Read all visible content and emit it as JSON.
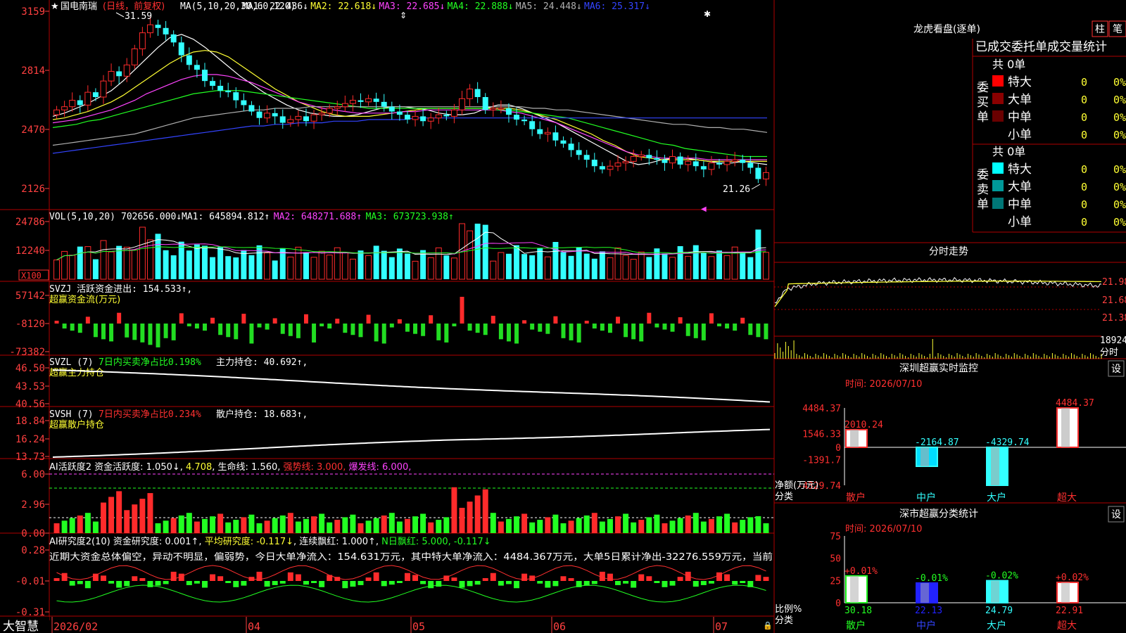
{
  "app": {
    "name": "大智慧",
    "stock_name": "国电南瑞",
    "period": "日线，前复权"
  },
  "colors": {
    "up": "#ff2b2b",
    "down": "#33ffff",
    "bg": "#000000",
    "grid": "#b00000",
    "axis_label": "#ff4040",
    "yellow": "#ffff33",
    "magenta": "#ff44ff",
    "green": "#22ff22",
    "white": "#ffffff",
    "blue": "#3344ff",
    "gray": "#b0b0b0"
  },
  "kline": {
    "ma_header": "MA(5,10,20,30,60,120)",
    "ma_items": [
      {
        "label": "MA1: 22.436↓",
        "color": "#ffffff"
      },
      {
        "label": "MA2: 22.618↓",
        "color": "#ffff33"
      },
      {
        "label": "MA3: 22.685↓",
        "color": "#ff44ff"
      },
      {
        "label": "MA4: 22.888↓",
        "color": "#22ff22"
      },
      {
        "label": "MA5: 24.448↓",
        "color": "#b0b0b0"
      },
      {
        "label": "MA6: 25.317↓",
        "color": "#3344ff"
      }
    ],
    "y_ticks": [
      "3159",
      "2814",
      "2470",
      "2126"
    ],
    "high_label": "31.59",
    "low_label": "21.26"
  },
  "vol": {
    "header": "VOL(5,10,20)",
    "value": "702656.000↓",
    "ma_items": [
      {
        "label": "MA1: 645894.812↑",
        "color": "#ffffff"
      },
      {
        "label": "MA2: 648271.688↑",
        "color": "#ff44ff"
      },
      {
        "label": "MA3: 673723.938↑",
        "color": "#22ff22"
      }
    ],
    "y_ticks": [
      "24786",
      "12240"
    ],
    "unit": "X100"
  },
  "svzj": {
    "header": "SVZJ  活跃资金进出: 154.533↑,",
    "sub": "超赢资金流(万元)",
    "y_ticks": [
      "57142",
      "-8120",
      "-73382"
    ]
  },
  "svzl": {
    "header": "SVZL (7) ",
    "ratio": "7日内买卖净占比0.198%",
    "main": "主力持仓: 40.692↑,",
    "sub": "超赢主力持仓",
    "y_ticks": [
      "46.50",
      "43.53",
      "40.56"
    ]
  },
  "svsh": {
    "header": "SVSH (7) ",
    "ratio": "7日内买卖净占比0.234%",
    "main": "散户持仓: 18.683↑,",
    "sub": "超赢散户持仓",
    "y_ticks": [
      "18.84",
      "16.24",
      "13.73"
    ]
  },
  "ai_hy": {
    "header": "AI活跃度2 资金活跃度: 1.050↓, ",
    "val2": "4.708",
    "life": ", 生命线: 1.560, ",
    "strong": "强势线: 3.000, ",
    "burst": "爆发线: 6.000,",
    "y_ticks": [
      "6.00",
      "2.96",
      "0.00"
    ]
  },
  "ai_yj": {
    "header": "AI研究度2(10) 资金研究度: 0.001↑, ",
    "avg": "平均研究度: -0.117↓",
    "lx": ", 连续飘红: 1.000↑, ",
    "nr": "N日飘红: 5.000, -0.117↓",
    "comment": "近期大资金总体偏空，异动不明显，偏弱势，今日大单净流入：154.631万元，其中特大单净流入：4484.367万元，大单5日累计净出-32276.559万元，当前",
    "y_ticks": [
      "0.28",
      "-0.01",
      "-0.31"
    ]
  },
  "xaxis": {
    "labels": [
      "2026/02",
      "04",
      "05",
      "06",
      "07"
    ]
  },
  "dragon": {
    "title": "龙虎看盘(逐单)",
    "btn1": "柱",
    "btn2": "笔",
    "tabs": [
      "已成交",
      "委托单",
      "成交量",
      "统计"
    ],
    "buy_label": "委买单",
    "sell_label": "委卖单",
    "buy_total": "共 0单",
    "sell_total": "共 0单",
    "buy_rows": [
      {
        "name": "特大",
        "val": "0",
        "pct": "0%",
        "color": "#ff0000"
      },
      {
        "name": "大单",
        "val": "0",
        "pct": "0%",
        "color": "#8a0000"
      },
      {
        "name": "中单",
        "val": "0",
        "pct": "0%",
        "color": "#6a0000"
      },
      {
        "name": "小单",
        "val": "0",
        "pct": "0%",
        "color": "#000000"
      }
    ],
    "sell_rows": [
      {
        "name": "特大",
        "val": "0",
        "pct": "0%",
        "color": "#00ffff"
      },
      {
        "name": "大单",
        "val": "0",
        "pct": "0%",
        "color": "#009999"
      },
      {
        "name": "中单",
        "val": "0",
        "pct": "0%",
        "color": "#007777"
      },
      {
        "name": "小单",
        "val": "0",
        "pct": "0%",
        "color": "#000000"
      }
    ]
  },
  "intraday": {
    "title": "分时走势",
    "y_ticks": [
      "21.98",
      "21.68",
      "21.38"
    ],
    "vol_tick": "18924",
    "vol_unit": "分时"
  },
  "monitor": {
    "title": "深圳超赢实时监控",
    "btn": "设",
    "time": "时间: 2026/07/10",
    "y_ticks": [
      "4484.37",
      "1546.33",
      "0",
      "-1391.7",
      "-4329.74"
    ],
    "ylabel": "净额(万元)",
    "xlabel": "分类",
    "categories": [
      "散户",
      "中户",
      "大户",
      "超大"
    ],
    "values_labels": [
      "2010.24",
      "-2164.87",
      "-4329.74",
      "4484.37"
    ]
  },
  "classify": {
    "title": "深市超赢分类统计",
    "btn": "设",
    "time": "时间: 2026/07/10",
    "y_ticks": [
      "75",
      "50",
      "25",
      "0"
    ],
    "ylabel": "比例%",
    "xlabel": "分类",
    "categories": [
      "散户",
      "中户",
      "大户",
      "超大"
    ],
    "values_labels": [
      "30.18",
      "22.13",
      "24.79",
      "22.91"
    ],
    "change_labels": [
      "+0.01%",
      "-0.01%",
      "-0.02%",
      "+0.02%"
    ]
  },
  "chart_data": [
    {
      "type": "candlestick",
      "title": "国电南瑞",
      "x": [
        "2026/02",
        "04",
        "05",
        "06",
        "07"
      ],
      "ylim": [
        21.26,
        31.59
      ],
      "close": [
        25.8,
        26.0,
        26.4,
        26.1,
        26.9,
        26.6,
        27.6,
        28.2,
        27.9,
        28.6,
        29.6,
        30.6,
        31.1,
        30.9,
        30.5,
        30.0,
        29.2,
        28.6,
        28.3,
        27.6,
        27.3,
        27.0,
        26.9,
        26.4,
        26.1,
        25.7,
        25.3,
        25.6,
        25.4,
        25.0,
        25.2,
        25.4,
        25.1,
        25.5,
        25.6,
        25.9,
        26.0,
        26.2,
        26.4,
        26.3,
        26.5,
        26.3,
        26.0,
        25.7,
        25.5,
        25.2,
        25.4,
        25.1,
        25.3,
        25.5,
        25.4,
        25.8,
        26.5,
        27.1,
        26.6,
        25.8,
        25.9,
        25.9,
        25.5,
        25.2,
        25.1,
        24.6,
        24.3,
        24.4,
        23.9,
        23.7,
        23.3,
        23.0,
        22.7,
        22.3,
        22.1,
        22.3,
        22.5,
        22.6,
        22.9,
        23.0,
        22.8,
        22.7,
        22.5,
        22.9,
        22.4,
        22.6,
        22.3,
        22.1,
        22.5,
        22.4,
        22.6,
        22.7,
        22.5,
        22.2,
        21.5,
        21.9
      ],
      "series": [
        {
          "name": "MA1",
          "values": [
            25.4,
            25.6,
            25.9,
            26.2,
            26.6,
            27.0,
            27.6,
            28.3,
            29.0,
            29.7,
            30.3,
            30.5,
            30.2,
            29.7,
            29.1,
            28.5,
            27.9,
            27.4,
            26.9,
            26.5,
            26.1,
            25.8,
            25.6,
            25.5,
            25.4,
            25.4,
            25.5,
            25.7,
            25.9,
            26.0,
            26.0,
            25.9,
            25.8,
            25.6,
            25.5,
            25.5,
            25.6,
            25.9,
            26.1,
            26.1,
            25.9,
            25.6,
            25.3,
            25.0,
            24.6,
            24.2,
            23.8,
            23.4,
            23.0,
            22.6,
            22.4,
            22.5,
            22.7,
            22.8,
            22.8,
            22.7,
            22.6,
            22.5,
            22.5,
            22.6,
            22.5,
            22.4
          ]
        },
        {
          "name": "MA2",
          "values": [
            25.2,
            25.3,
            25.5,
            25.7,
            26.0,
            26.3,
            26.7,
            27.2,
            27.7,
            28.2,
            28.7,
            29.1,
            29.4,
            29.5,
            29.4,
            29.1,
            28.6,
            28.1,
            27.6,
            27.1,
            26.7,
            26.3,
            26.0,
            25.7,
            25.5,
            25.4,
            25.4,
            25.4,
            25.5,
            25.6,
            25.7,
            25.8,
            25.9,
            25.9,
            25.9,
            25.9,
            25.9,
            25.9,
            25.9,
            25.9,
            25.8,
            25.6,
            25.4,
            25.2,
            24.9,
            24.6,
            24.3,
            23.9,
            23.6,
            23.2,
            22.9,
            22.8,
            22.7,
            22.7,
            22.7,
            22.7,
            22.6,
            22.6,
            22.6,
            22.6,
            22.6,
            22.6
          ]
        },
        {
          "name": "MA3",
          "values": [
            25.0,
            25.1,
            25.2,
            25.4,
            25.6,
            25.8,
            26.1,
            26.4,
            26.8,
            27.1,
            27.4,
            27.7,
            27.9,
            28.0,
            28.0,
            27.9,
            27.7,
            27.5,
            27.2,
            26.9,
            26.6,
            26.3,
            26.1,
            25.9,
            25.8,
            25.7,
            25.6,
            25.6,
            25.6,
            25.6,
            25.7,
            25.7,
            25.8,
            25.8,
            25.8,
            25.8,
            25.8,
            25.8,
            25.8,
            25.7,
            25.6,
            25.4,
            25.2,
            25.0,
            24.7,
            24.4,
            24.1,
            23.8,
            23.5,
            23.2,
            23.0,
            22.9,
            22.8,
            22.8,
            22.8,
            22.8,
            22.7,
            22.7,
            22.7,
            22.7,
            22.7,
            22.7
          ]
        },
        {
          "name": "MA4",
          "values": [
            24.7,
            24.8,
            24.9,
            25.1,
            25.2,
            25.4,
            25.6,
            25.8,
            26.0,
            26.2,
            26.4,
            26.6,
            26.8,
            26.9,
            27.0,
            27.0,
            27.0,
            26.9,
            26.8,
            26.7,
            26.6,
            26.5,
            26.4,
            26.3,
            26.2,
            26.1,
            26.0,
            25.9,
            25.9,
            25.9,
            25.9,
            25.9,
            25.9,
            25.9,
            25.9,
            25.9,
            25.9,
            25.9,
            25.8,
            25.8,
            25.7,
            25.6,
            25.5,
            25.4,
            25.3,
            25.1,
            24.9,
            24.7,
            24.5,
            24.3,
            24.1,
            23.9,
            23.7,
            23.6,
            23.4,
            23.3,
            23.2,
            23.1,
            23.0,
            22.9,
            22.9,
            22.9
          ]
        },
        {
          "name": "MA5",
          "values": [
            23.6,
            23.7,
            23.8,
            23.9,
            24.0,
            24.1,
            24.2,
            24.3,
            24.5,
            24.7,
            24.9,
            25.1,
            25.3,
            25.4,
            25.5,
            25.6,
            25.7,
            25.8,
            25.8,
            25.9,
            25.9,
            25.9,
            26.0,
            26.0,
            26.0,
            26.0,
            26.0,
            26.0,
            26.0,
            26.0,
            26.0,
            26.0,
            26.0,
            26.0,
            26.0,
            26.0,
            26.0,
            26.0,
            26.0,
            26.0,
            26.0,
            25.9,
            25.9,
            25.8,
            25.8,
            25.7,
            25.6,
            25.5,
            25.4,
            25.3,
            25.2,
            25.1,
            25.0,
            24.9,
            24.9,
            24.8,
            24.7,
            24.7,
            24.6,
            24.6,
            24.5,
            24.4
          ]
        },
        {
          "name": "MA6",
          "values": [
            23.1,
            23.2,
            23.3,
            23.4,
            23.5,
            23.6,
            23.7,
            23.8,
            23.9,
            24.0,
            24.1,
            24.2,
            24.3,
            24.4,
            24.5,
            24.6,
            24.7,
            24.8,
            24.8,
            24.9,
            24.9,
            25.0,
            25.0,
            25.0,
            25.1,
            25.1,
            25.1,
            25.2,
            25.2,
            25.2,
            25.2,
            25.3,
            25.3,
            25.3,
            25.3,
            25.3,
            25.3,
            25.3,
            25.3,
            25.3,
            25.3,
            25.3,
            25.3,
            25.3,
            25.3,
            25.3,
            25.3,
            25.3,
            25.3,
            25.3,
            25.3,
            25.3,
            25.3,
            25.3,
            25.3,
            25.3,
            25.3,
            25.3,
            25.3,
            25.3,
            25.3,
            25.3
          ]
        }
      ]
    },
    {
      "type": "bar",
      "title": "深圳超赢实时监控",
      "categories": [
        "散户",
        "中户",
        "大户",
        "超大"
      ],
      "values": [
        2010.24,
        -2164.87,
        -4329.74,
        4484.37
      ],
      "ylabel": "净额(万元)",
      "ylim": [
        -4329.74,
        4484.37
      ]
    },
    {
      "type": "bar",
      "title": "深市超赢分类统计",
      "categories": [
        "散户",
        "中户",
        "大户",
        "超大"
      ],
      "values": [
        30.18,
        22.13,
        24.79,
        22.91
      ],
      "ylabel": "比例%",
      "ylim": [
        0,
        75
      ]
    }
  ]
}
